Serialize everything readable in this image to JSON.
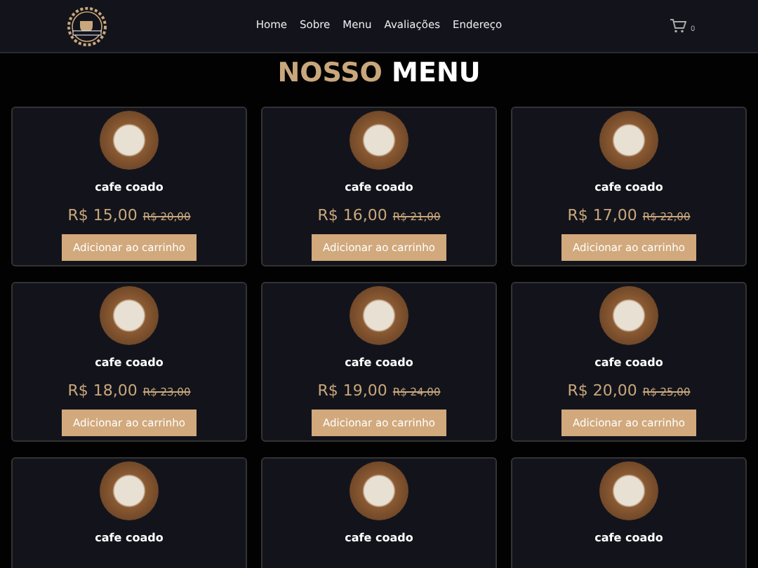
{
  "nav": {
    "links": [
      "Home",
      "Sobre",
      "Menu",
      "Avaliações",
      "Endereço"
    ],
    "cart_count": "0"
  },
  "heading": {
    "accent": "NOSSO",
    "rest": "MENU"
  },
  "products": [
    {
      "name": "cafe coado",
      "price": "R$ 15,00",
      "old_price": "R$ 20,00",
      "button": "Adicionar ao carrinho"
    },
    {
      "name": "cafe coado",
      "price": "R$ 16,00",
      "old_price": "R$ 21,00",
      "button": "Adicionar ao carrinho"
    },
    {
      "name": "cafe coado",
      "price": "R$ 17,00",
      "old_price": "R$ 22,00",
      "button": "Adicionar ao carrinho"
    },
    {
      "name": "cafe coado",
      "price": "R$ 18,00",
      "old_price": "R$ 23,00",
      "button": "Adicionar ao carrinho"
    },
    {
      "name": "cafe coado",
      "price": "R$ 19,00",
      "old_price": "R$ 24,00",
      "button": "Adicionar ao carrinho"
    },
    {
      "name": "cafe coado",
      "price": "R$ 20,00",
      "old_price": "R$ 25,00",
      "button": "Adicionar ao carrinho"
    },
    {
      "name": "cafe coado"
    },
    {
      "name": "cafe coado"
    },
    {
      "name": "cafe coado"
    }
  ]
}
